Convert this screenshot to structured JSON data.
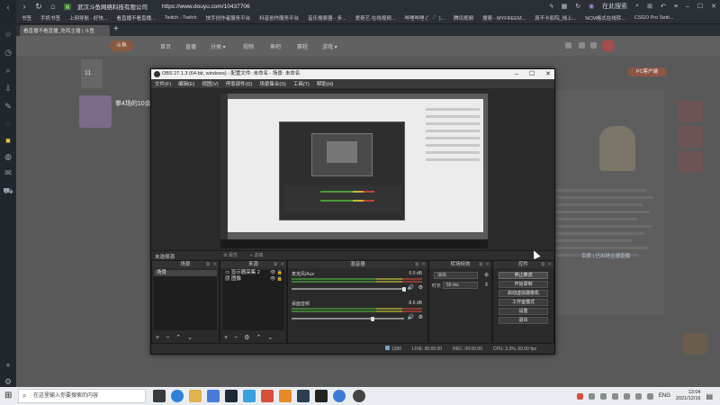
{
  "browser": {
    "site_name": "武汉斗鱼网络科技有限公司",
    "url": "https://www.douyu.com/10437706",
    "search_label": "在此搜索",
    "bookmarks": [
      "书签",
      "手机书签",
      "上网导航 - 好快...",
      "看直播不看直播...",
      "Twitch - Twitch",
      "快手创作者服务平台",
      "抖音创作服务平台",
      "音乐搜索器 - 多...",
      "爱奇艺-在线视频...",
      "哔哩哔哩 (゜-゜)...",
      "腾讯视频",
      "搜索 - MYFREEM...",
      "真不卡影院_线上...",
      "NCM格式在线转...",
      "CSGO Pro Setti..."
    ],
    "tab_title": "看直播不看直播_吃鸡主播 | 斗鱼"
  },
  "douyu": {
    "logo": "斗鱼",
    "nav": [
      "首页",
      "直播",
      "分类 ▾",
      "视频",
      "鱼吧",
      "赛程",
      "游戏 ▾"
    ],
    "count": "11",
    "streamer": "拳4场的10余...",
    "pc_client": "PC客户端",
    "ad_link": "百度 | 已出场主播直播"
  },
  "obs": {
    "title": "OBS 27.1.3 (64-bit, windows) - 配置文件: 未命名 - 场景: 未命名",
    "menu": [
      "文件(F)",
      "编辑(E)",
      "视图(V)",
      "停靠部件(D)",
      "场景集合(S)",
      "工具(T)",
      "帮助(H)"
    ],
    "no_source": "未选择源",
    "properties": "⚙ 属性",
    "filters": "◐ 滤镜",
    "docks": {
      "scenes": {
        "title": "场景",
        "items": [
          "场景"
        ]
      },
      "sources": {
        "title": "来源",
        "items": [
          "显示器采集 2",
          "图像"
        ]
      },
      "mixer": {
        "title": "混音器",
        "channels": [
          {
            "name": "麦克风/Aux",
            "db": "0.0 dB",
            "volume": 1.0
          },
          {
            "name": "桌面音频",
            "db": "-8.6 dB",
            "volume": 0.72
          }
        ]
      },
      "transitions": {
        "title": "转场特效",
        "transition": "淡出",
        "duration_label": "时长",
        "duration": "50 ms"
      },
      "controls": {
        "title": "控件",
        "buttons": [
          "停止推流",
          "开始录制",
          "启动虚拟摄像机",
          "工作室模式",
          "设置",
          "退出"
        ]
      }
    },
    "status": {
      "dropped": "1280",
      "live": "LIVE: 00:00:00",
      "rec": "REC: 00:00:00",
      "cpu": "CPU: 2.3%, 60.00 fps"
    }
  },
  "taskbar": {
    "search_placeholder": "在这里输入你要搜索的内容",
    "lang": "ENG",
    "time": "13:04",
    "date": "2021/12/16"
  }
}
